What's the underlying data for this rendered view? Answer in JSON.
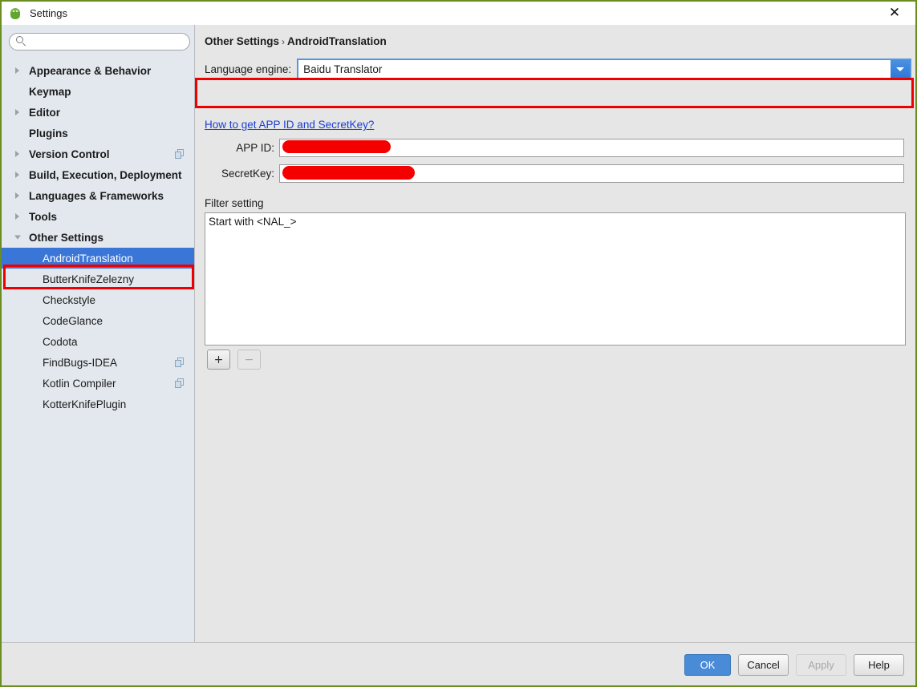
{
  "window": {
    "title": "Settings",
    "app_icon": "android-robot-icon",
    "close_label": "✕",
    "frame_color": "#6b8e23"
  },
  "sidebar": {
    "search": {
      "value": "",
      "placeholder": "",
      "icon": "search-icon"
    },
    "items": [
      {
        "label": "Appearance & Behavior",
        "level": 0,
        "twisty": "closed",
        "selected": false,
        "badge": false
      },
      {
        "label": "Keymap",
        "level": 0,
        "twisty": "none",
        "selected": false,
        "badge": false
      },
      {
        "label": "Editor",
        "level": 0,
        "twisty": "closed",
        "selected": false,
        "badge": false
      },
      {
        "label": "Plugins",
        "level": 0,
        "twisty": "none",
        "selected": false,
        "badge": false
      },
      {
        "label": "Version Control",
        "level": 0,
        "twisty": "closed",
        "selected": false,
        "badge": true
      },
      {
        "label": "Build, Execution, Deployment",
        "level": 0,
        "twisty": "closed",
        "selected": false,
        "badge": false
      },
      {
        "label": "Languages & Frameworks",
        "level": 0,
        "twisty": "closed",
        "selected": false,
        "badge": false
      },
      {
        "label": "Tools",
        "level": 0,
        "twisty": "closed",
        "selected": false,
        "badge": false
      },
      {
        "label": "Other Settings",
        "level": 0,
        "twisty": "open",
        "selected": false,
        "badge": false
      },
      {
        "label": "AndroidTranslation",
        "level": 1,
        "twisty": "none",
        "selected": true,
        "badge": false
      },
      {
        "label": "ButterKnifeZelezny",
        "level": 1,
        "twisty": "none",
        "selected": false,
        "badge": false
      },
      {
        "label": "Checkstyle",
        "level": 1,
        "twisty": "none",
        "selected": false,
        "badge": false
      },
      {
        "label": "CodeGlance",
        "level": 1,
        "twisty": "none",
        "selected": false,
        "badge": false
      },
      {
        "label": "Codota",
        "level": 1,
        "twisty": "none",
        "selected": false,
        "badge": false
      },
      {
        "label": "FindBugs-IDEA",
        "level": 1,
        "twisty": "none",
        "selected": false,
        "badge": true
      },
      {
        "label": "Kotlin Compiler",
        "level": 1,
        "twisty": "none",
        "selected": false,
        "badge": true
      },
      {
        "label": "KotterKnifePlugin",
        "level": 1,
        "twisty": "none",
        "selected": false,
        "badge": false
      }
    ],
    "selection_highlight_color": "#3a75d8",
    "annotation_color": "#ee0000"
  },
  "content": {
    "breadcrumb": {
      "root": "Other Settings",
      "separator": "›",
      "leaf": "AndroidTranslation"
    },
    "engine": {
      "label": "Language engine:",
      "value": "Baidu Translator",
      "arrow_icon": "chevron-down-icon"
    },
    "help_link": "How to get APP ID and SecretKey?",
    "fields": [
      {
        "label": "APP ID:",
        "value": "",
        "redacted": true
      },
      {
        "label": "SecretKey:",
        "value": "",
        "redacted": true
      }
    ],
    "filter": {
      "label": "Filter setting",
      "rows": [
        "Start with <NAL_>"
      ],
      "add_label": "+",
      "remove_label": "−"
    }
  },
  "footer": {
    "buttons": [
      {
        "label": "OK",
        "style": "primary",
        "enabled": true
      },
      {
        "label": "Cancel",
        "style": "normal",
        "enabled": true
      },
      {
        "label": "Apply",
        "style": "normal",
        "enabled": false
      },
      {
        "label": "Help",
        "style": "normal",
        "enabled": true
      }
    ]
  }
}
